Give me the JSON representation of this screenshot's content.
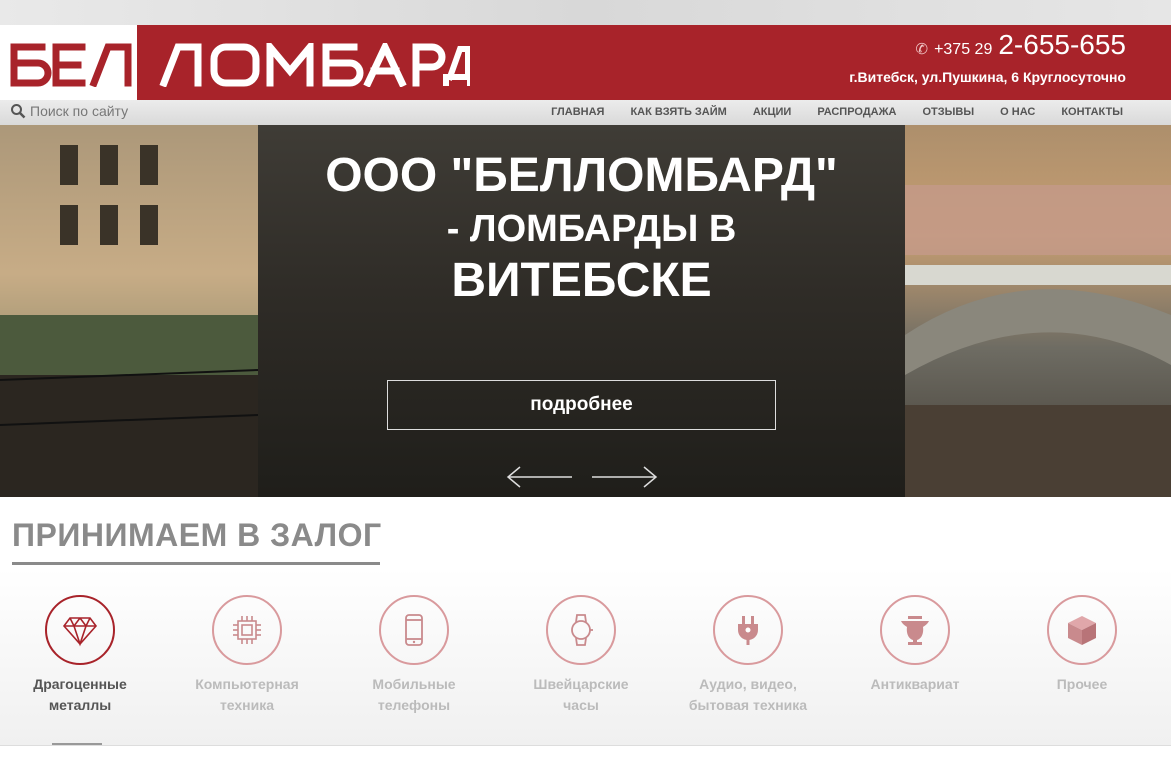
{
  "brand": {
    "logo_text": "БЕЛЛОМБАРД",
    "accent": "#a8232a"
  },
  "contact": {
    "phone_code": "+375 29",
    "phone_number": "2-655-655",
    "address": "г.Витебск, ул.Пушкина, 6 Круглосуточно"
  },
  "search": {
    "placeholder": "Поиск по сайту"
  },
  "nav": {
    "items": [
      "ГЛАВНАЯ",
      "КАК ВЗЯТЬ ЗАЙМ",
      "АКЦИИ",
      "РАСПРОДАЖА",
      "ОТЗЫВЫ",
      "О НАС",
      "КОНТАКТЫ"
    ]
  },
  "hero": {
    "line1": "ООО \"БЕЛЛОМБАРД\"",
    "line2": "- ЛОМБАРДЫ В",
    "line3": "ВИТЕБСКЕ",
    "button": "подробнее"
  },
  "section": {
    "title": "ПРИНИМАЕМ В ЗАЛОГ",
    "categories": [
      {
        "line1": "Драгоценные",
        "line2": "металлы",
        "icon": "diamond-icon"
      },
      {
        "line1": "Компьютерная",
        "line2": "техника",
        "icon": "chip-icon"
      },
      {
        "line1": "Мобильные",
        "line2": "телефоны",
        "icon": "phone-icon"
      },
      {
        "line1": "Швейцарские",
        "line2": "часы",
        "icon": "watch-icon"
      },
      {
        "line1": "Аудио, видео,",
        "line2": "бытовая техника",
        "icon": "plug-icon"
      },
      {
        "line1": "Антиквариат",
        "line2": "",
        "icon": "vase-icon"
      },
      {
        "line1": "Прочее",
        "line2": "",
        "icon": "box-icon"
      }
    ]
  }
}
